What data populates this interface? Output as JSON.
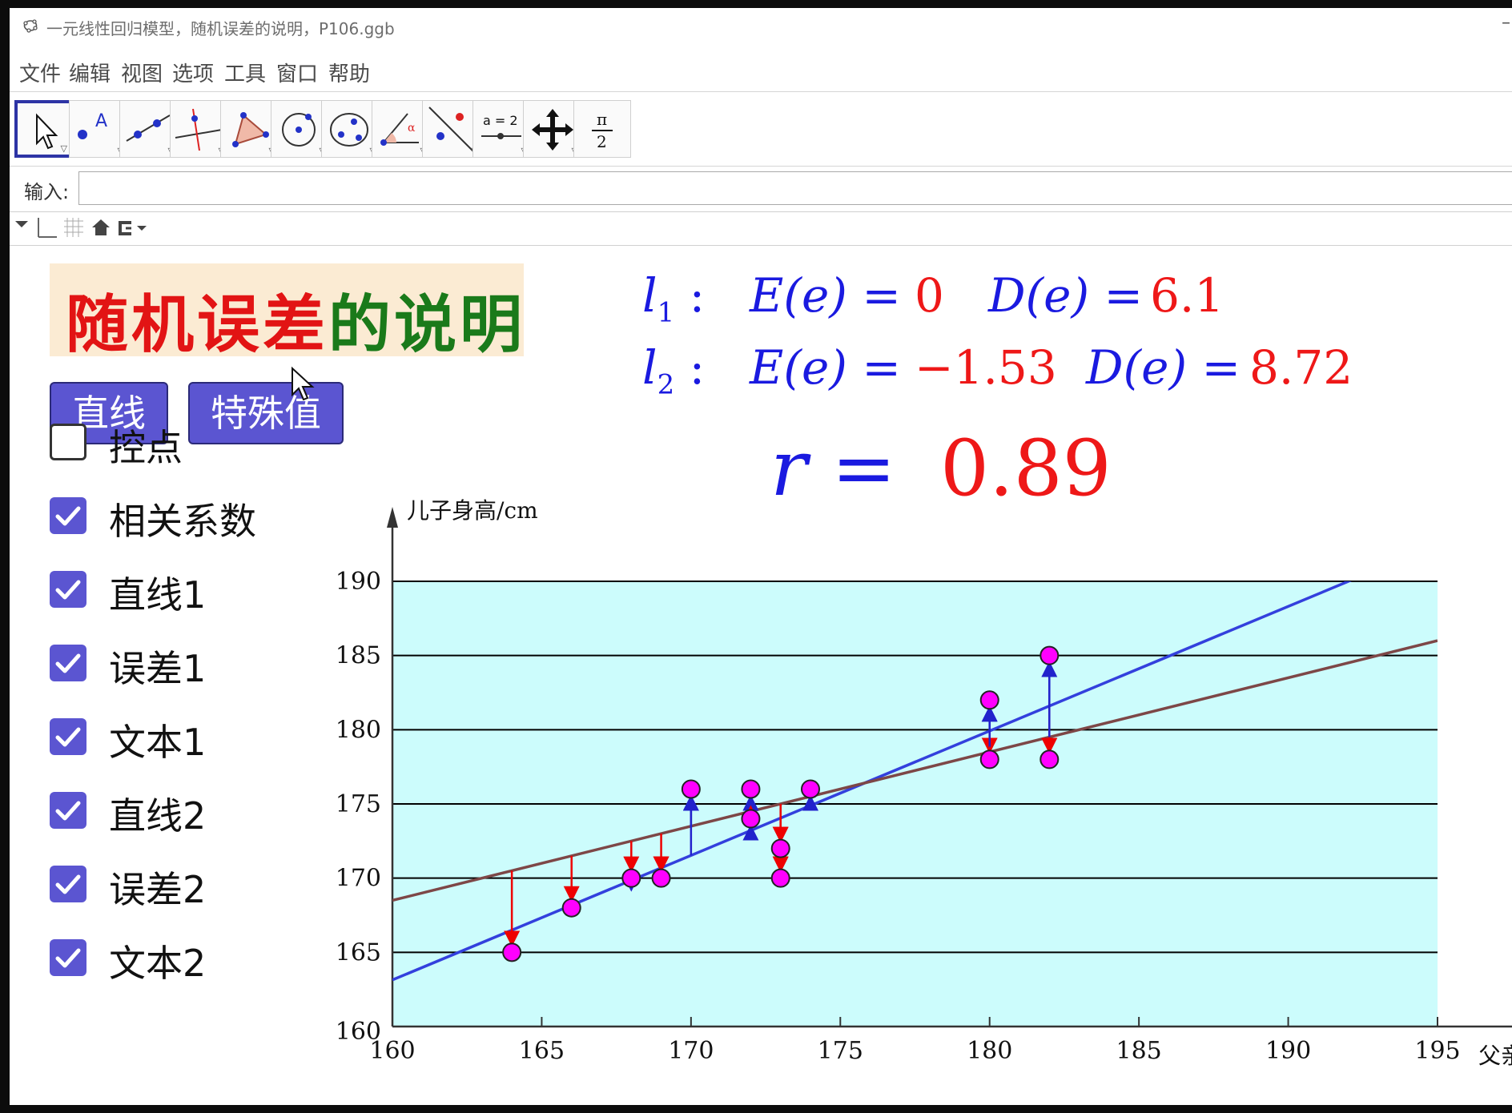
{
  "window": {
    "title": "一元线性回归模型，随机误差的说明，P106.ggb",
    "minimize": "–"
  },
  "menu": [
    "文件",
    "编辑",
    "视图",
    "选项",
    "工具",
    "窗口",
    "帮助"
  ],
  "toolbar": {
    "tools": [
      "move-icon",
      "point-icon",
      "line-icon",
      "perpendicular-line-icon",
      "polygon-icon",
      "circle-icon",
      "conic-icon",
      "angle-icon",
      "reflect-icon",
      "slider-icon",
      "move-graphics-icon",
      "fraction-icon"
    ],
    "slider_label": "a = 2",
    "selected": 0
  },
  "input": {
    "label": "输入:",
    "value": ""
  },
  "panel": {
    "title_parts": [
      {
        "text": "随机误差",
        "color": "#e21414"
      },
      {
        "text": "的说明",
        "color": "#1a7a1a"
      }
    ],
    "title_bg": "#fbebd3",
    "buttons": {
      "line": "直线",
      "special": "特殊值"
    },
    "accent": "#5b55d1"
  },
  "equations": {
    "l1": {
      "name": "l",
      "sub": "1",
      "E_label": "E(e) =",
      "E": "0",
      "D_label": "D(e) =",
      "D": "6.1"
    },
    "l2": {
      "name": "l",
      "sub": "2",
      "E_label": "E(e) =",
      "E": "−1.53",
      "D_label": "D(e) =",
      "D": "8.72"
    },
    "r": {
      "label": "r =",
      "value": "0.89"
    }
  },
  "checkboxes": [
    {
      "label": "控点",
      "checked": false
    },
    {
      "label": "相关系数",
      "checked": true
    },
    {
      "label": "直线1",
      "checked": true
    },
    {
      "label": "误差1",
      "checked": true
    },
    {
      "label": "文本1",
      "checked": true
    },
    {
      "label": "直线2",
      "checked": true
    },
    {
      "label": "误差2",
      "checked": true
    },
    {
      "label": "文本2",
      "checked": true
    }
  ],
  "chart_data": {
    "type": "scatter",
    "title": "",
    "xlabel": "父亲",
    "ylabel": "儿子身高/cm",
    "xlim": [
      160,
      195
    ],
    "ylim": [
      160,
      190
    ],
    "xticks": [
      160,
      165,
      170,
      175,
      180,
      185,
      190,
      195
    ],
    "yticks": [
      160,
      165,
      170,
      175,
      180,
      185,
      190
    ],
    "grid": "horizontal",
    "background": "#ccfcfc",
    "points": [
      {
        "x": 164,
        "y": 165
      },
      {
        "x": 166,
        "y": 168
      },
      {
        "x": 168,
        "y": 170
      },
      {
        "x": 169,
        "y": 170
      },
      {
        "x": 170,
        "y": 176
      },
      {
        "x": 172,
        "y": 176
      },
      {
        "x": 172,
        "y": 174
      },
      {
        "x": 173,
        "y": 172
      },
      {
        "x": 173,
        "y": 170
      },
      {
        "x": 174,
        "y": 176
      },
      {
        "x": 180,
        "y": 182
      },
      {
        "x": 180,
        "y": 178
      },
      {
        "x": 182,
        "y": 185
      },
      {
        "x": 182,
        "y": 178
      }
    ],
    "point_color": "#ff00ff",
    "series": [
      {
        "slope": 0.839,
        "intercept": 28.9,
        "color": "#3340dd"
      },
      {
        "slope": 0.5,
        "intercept": 88.5,
        "color": "#7d4747"
      }
    ],
    "error_colors": {
      "up": "#2222cc",
      "down": "#ee0000"
    }
  }
}
